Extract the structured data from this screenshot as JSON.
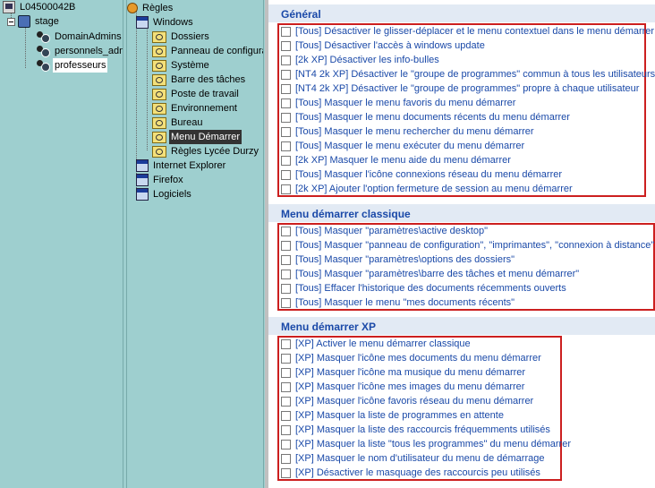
{
  "left_tree": {
    "root": "L04500042B",
    "stage": "stage",
    "children": [
      "DomainAdmins",
      "personnels_adm",
      "professeurs"
    ]
  },
  "mid_tree": {
    "root": "Règles",
    "windows": "Windows",
    "windows_children": [
      "Dossiers",
      "Panneau de configura",
      "Système",
      "Barre des tâches",
      "Poste de travail",
      "Environnement",
      "Bureau",
      "Menu Démarrer",
      "Règles Lycée Durzy"
    ],
    "other": [
      "Internet Explorer",
      "Firefox",
      "Logiciels"
    ]
  },
  "sections": [
    {
      "title": "Général",
      "items": [
        "[Tous] Désactiver le glisser-déplacer et le menu contextuel dans le menu démarrer",
        "[Tous] Désactiver l'accès à windows update",
        "[2k XP] Désactiver les info-bulles",
        "[NT4 2k XP] Désactiver le \"groupe de programmes\" commun à tous les utilisateurs",
        "[NT4 2k XP] Désactiver le \"groupe de programmes\" propre à chaque utilisateur",
        "[Tous] Masquer le menu favoris du menu démarrer",
        "[Tous] Masquer le menu documents récents du menu démarrer",
        "[Tous] Masquer le menu rechercher du menu démarrer",
        "[Tous] Masquer le menu exécuter du menu démarrer",
        "[2k XP] Masquer le menu aide du menu démarrer",
        "[Tous] Masquer l'icône connexions réseau du menu démarrer",
        "[2k XP] Ajouter l'option fermeture de session au menu démarrer"
      ]
    },
    {
      "title": "Menu démarrer classique",
      "items": [
        "[Tous] Masquer \"paramètres\\active desktop\"",
        "[Tous] Masquer \"panneau de configuration\", \"imprimantes\", \"connexion à distance\"",
        "[Tous] Masquer \"paramètres\\options des dossiers\"",
        "[Tous] Masquer \"paramètres\\barre des tâches et menu démarrer\"",
        "[Tous] Effacer l'historique des documents récemments ouverts",
        "[Tous] Masquer le menu \"mes documents récents\""
      ]
    },
    {
      "title": "Menu démarrer XP",
      "items": [
        "[XP] Activer le menu démarrer classique",
        "[XP] Masquer l'icône mes documents du menu démarrer",
        "[XP] Masquer l'icône ma musique du menu démarrer",
        "[XP] Masquer l'icône mes images du menu démarrer",
        "[XP] Masquer l'icône favoris réseau du menu démarrer",
        "[XP] Masquer la liste de programmes en attente",
        "[XP] Masquer la liste des raccourcis fréquemments utilisés",
        "[XP] Masquer la liste \"tous les programmes\" du menu démarrer",
        "[XP] Masquer le nom d'utilisateur du menu de démarrage",
        "[XP] Désactiver le masquage des raccourcis peu utilisés"
      ]
    }
  ]
}
